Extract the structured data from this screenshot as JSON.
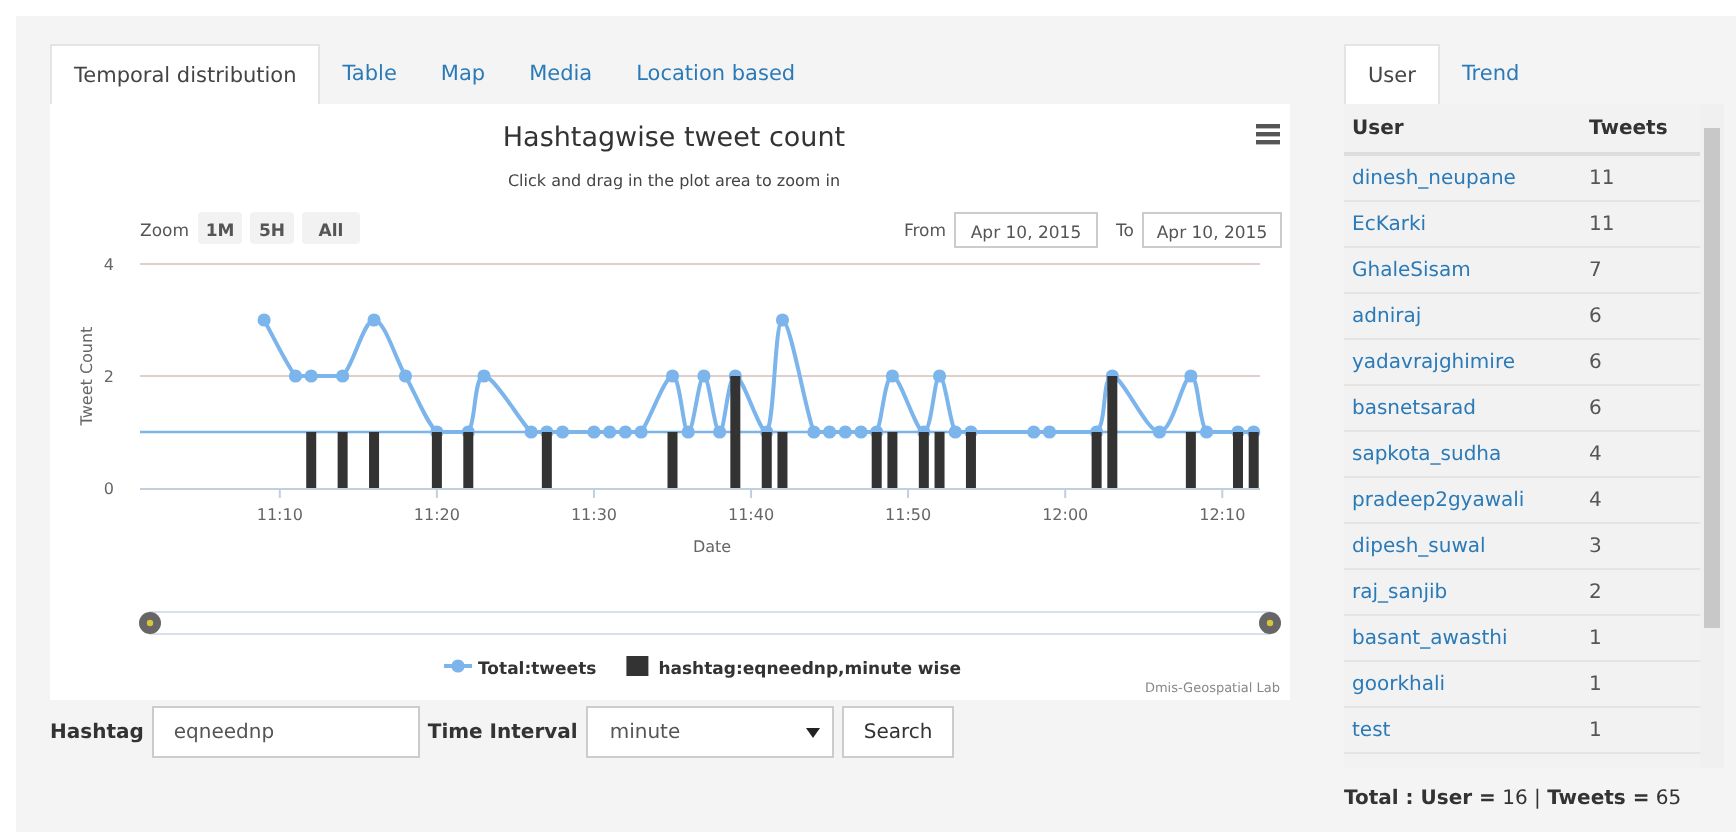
{
  "left_tabs": [
    {
      "label": "Temporal distribution",
      "selected": true
    },
    {
      "label": "Table",
      "selected": false
    },
    {
      "label": "Map",
      "selected": false
    },
    {
      "label": "Media",
      "selected": false
    },
    {
      "label": "Location based",
      "selected": false
    }
  ],
  "chart": {
    "title": "Hashtagwise tweet count",
    "subtitle": "Click and drag in the plot area to zoom in",
    "zoom_label": "Zoom",
    "zoom_buttons": [
      "1M",
      "5H",
      "All"
    ],
    "from_label": "From",
    "from_value": "Apr 10, 2015",
    "to_label": "To",
    "to_value": "Apr 10, 2015",
    "credits": "Dmis-Geospatial Lab",
    "chart_data": {
      "type": "line",
      "xlabel": "Date",
      "ylabel": "Tweet Count",
      "categories": [
        null,
        "11:10",
        null,
        null,
        null,
        null,
        null,
        null,
        null,
        null,
        null,
        "11:20",
        null,
        null,
        null,
        null,
        null,
        null,
        null,
        null,
        null,
        "11:30",
        null,
        null,
        null,
        null,
        null,
        null,
        null,
        null,
        null,
        "11:40",
        null,
        null,
        null,
        null,
        null,
        null,
        null,
        null,
        null,
        "11:50",
        null,
        null,
        null,
        null,
        null,
        null,
        null,
        null,
        null,
        "12:00",
        null,
        null,
        null,
        null,
        null,
        null,
        null,
        null,
        null,
        "12:10",
        null,
        null
      ],
      "series": [
        {
          "name": "Total:tweets",
          "marker": true,
          "color": "#7cb5ec",
          "values": [
            3,
            null,
            2,
            2,
            null,
            2,
            null,
            3,
            null,
            2,
            null,
            1,
            null,
            1,
            2,
            null,
            null,
            1,
            1,
            1,
            null,
            1,
            1,
            1,
            1,
            null,
            2,
            1,
            2,
            1,
            2,
            null,
            1,
            3,
            null,
            1,
            1,
            1,
            1,
            1,
            2,
            null,
            1,
            2,
            1,
            1,
            null,
            null,
            null,
            1,
            1,
            null,
            null,
            1,
            2,
            null,
            null,
            1,
            null,
            2,
            1,
            null,
            1,
            1
          ]
        },
        {
          "name": "hashtag:eqneednp,minute wise",
          "type": "bar",
          "color": "#333333",
          "values": [
            null,
            null,
            null,
            1,
            null,
            1,
            null,
            1,
            null,
            null,
            null,
            1,
            null,
            1,
            null,
            null,
            null,
            null,
            1,
            null,
            null,
            null,
            null,
            null,
            null,
            null,
            1,
            null,
            null,
            null,
            2,
            null,
            1,
            1,
            null,
            null,
            null,
            null,
            null,
            1,
            1,
            null,
            1,
            1,
            null,
            1,
            null,
            null,
            null,
            null,
            null,
            null,
            null,
            1,
            2,
            null,
            null,
            null,
            null,
            1,
            null,
            null,
            1,
            1
          ]
        }
      ],
      "ylim": [
        0,
        4
      ],
      "yticks": [
        0,
        2,
        4
      ],
      "ref_lines": [
        {
          "axis": "y",
          "value": 1
        }
      ]
    }
  },
  "form": {
    "hashtag_label": "Hashtag",
    "hashtag_value": "eqneednp",
    "interval_label": "Time Interval",
    "interval_value": "minute",
    "search_button": "Search"
  },
  "right_tabs": [
    {
      "label": "User",
      "selected": true
    },
    {
      "label": "Trend",
      "selected": false
    }
  ],
  "user_table": {
    "columns": [
      "User",
      "Tweets"
    ],
    "rows": [
      {
        "user": "dinesh_neupane",
        "tweets": "11"
      },
      {
        "user": "EcKarki",
        "tweets": "11"
      },
      {
        "user": "GhaleSisam",
        "tweets": "7"
      },
      {
        "user": "adniraj",
        "tweets": "6"
      },
      {
        "user": "yadavrajghimire",
        "tweets": "6"
      },
      {
        "user": "basnetsarad",
        "tweets": "6"
      },
      {
        "user": "sapkota_sudha",
        "tweets": "4"
      },
      {
        "user": "pradeep2gyawali",
        "tweets": "4"
      },
      {
        "user": "dipesh_suwal",
        "tweets": "3"
      },
      {
        "user": "raj_sanjib",
        "tweets": "2"
      },
      {
        "user": "basant_awasthi",
        "tweets": "1"
      },
      {
        "user": "goorkhali",
        "tweets": "1"
      },
      {
        "user": "test",
        "tweets": "1"
      }
    ]
  },
  "total": "**Total : User =** 16 | **Tweets =** 65"
}
